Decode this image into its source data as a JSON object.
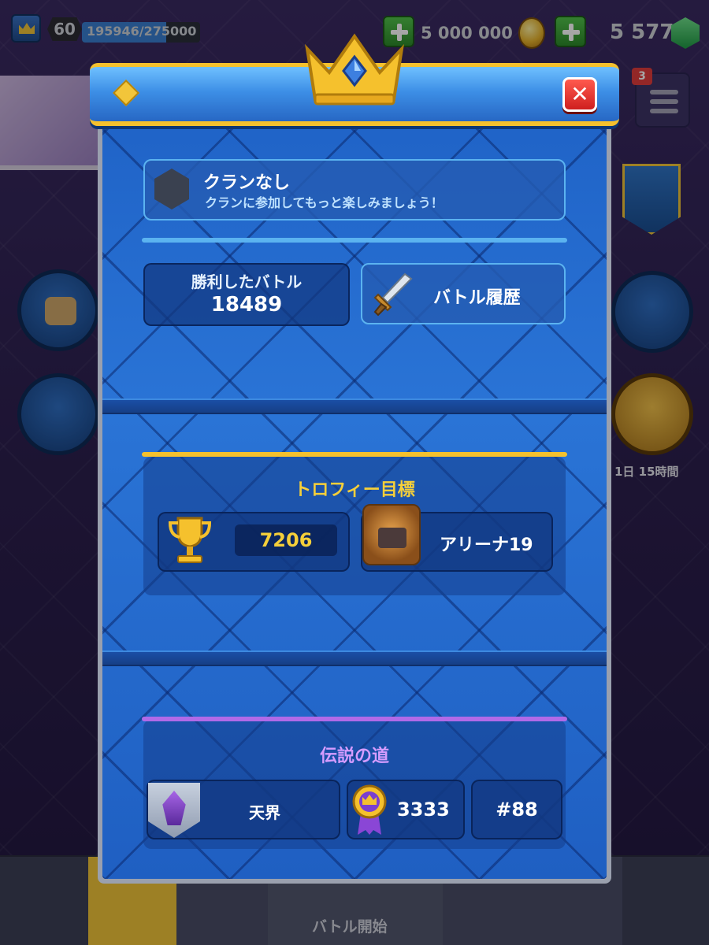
{
  "topbar": {
    "level": "60",
    "xp_text": "195946/275000",
    "xp_progress": 0.7125,
    "gold": "5 000 000",
    "gems": "5 577"
  },
  "menu_badge": "3",
  "timer_text": "1日 15時間",
  "bottom_nav": {
    "battle_label": "バトル開始"
  },
  "profile": {
    "clan": {
      "title": "クランなし",
      "subtitle": "クランに参加してもっと楽しみましょう！"
    },
    "wins": {
      "label": "勝利したバトル",
      "value": "18489"
    },
    "battle_log_label": "バトル履歴",
    "trophy_goal": {
      "title": "トロフィー目標",
      "trophies": "7206",
      "arena": "アリーナ19"
    },
    "path_of_legends": {
      "title": "伝説の道",
      "league": "天界",
      "rating": "3333",
      "rank": "#88"
    }
  },
  "colors": {
    "accent_gold": "#f5c12d",
    "modal_blue": "#2a74d6",
    "legend_purple": "#b06ae8",
    "trophy_text": "#f5cf3a"
  },
  "icons": [
    "crown-icon",
    "close-icon",
    "sword-icon",
    "trophy-icon",
    "arena-icon",
    "league-shield-icon",
    "medal-icon",
    "clan-hex-icon",
    "gold-coin-icon",
    "gem-icon",
    "menu-icon"
  ]
}
